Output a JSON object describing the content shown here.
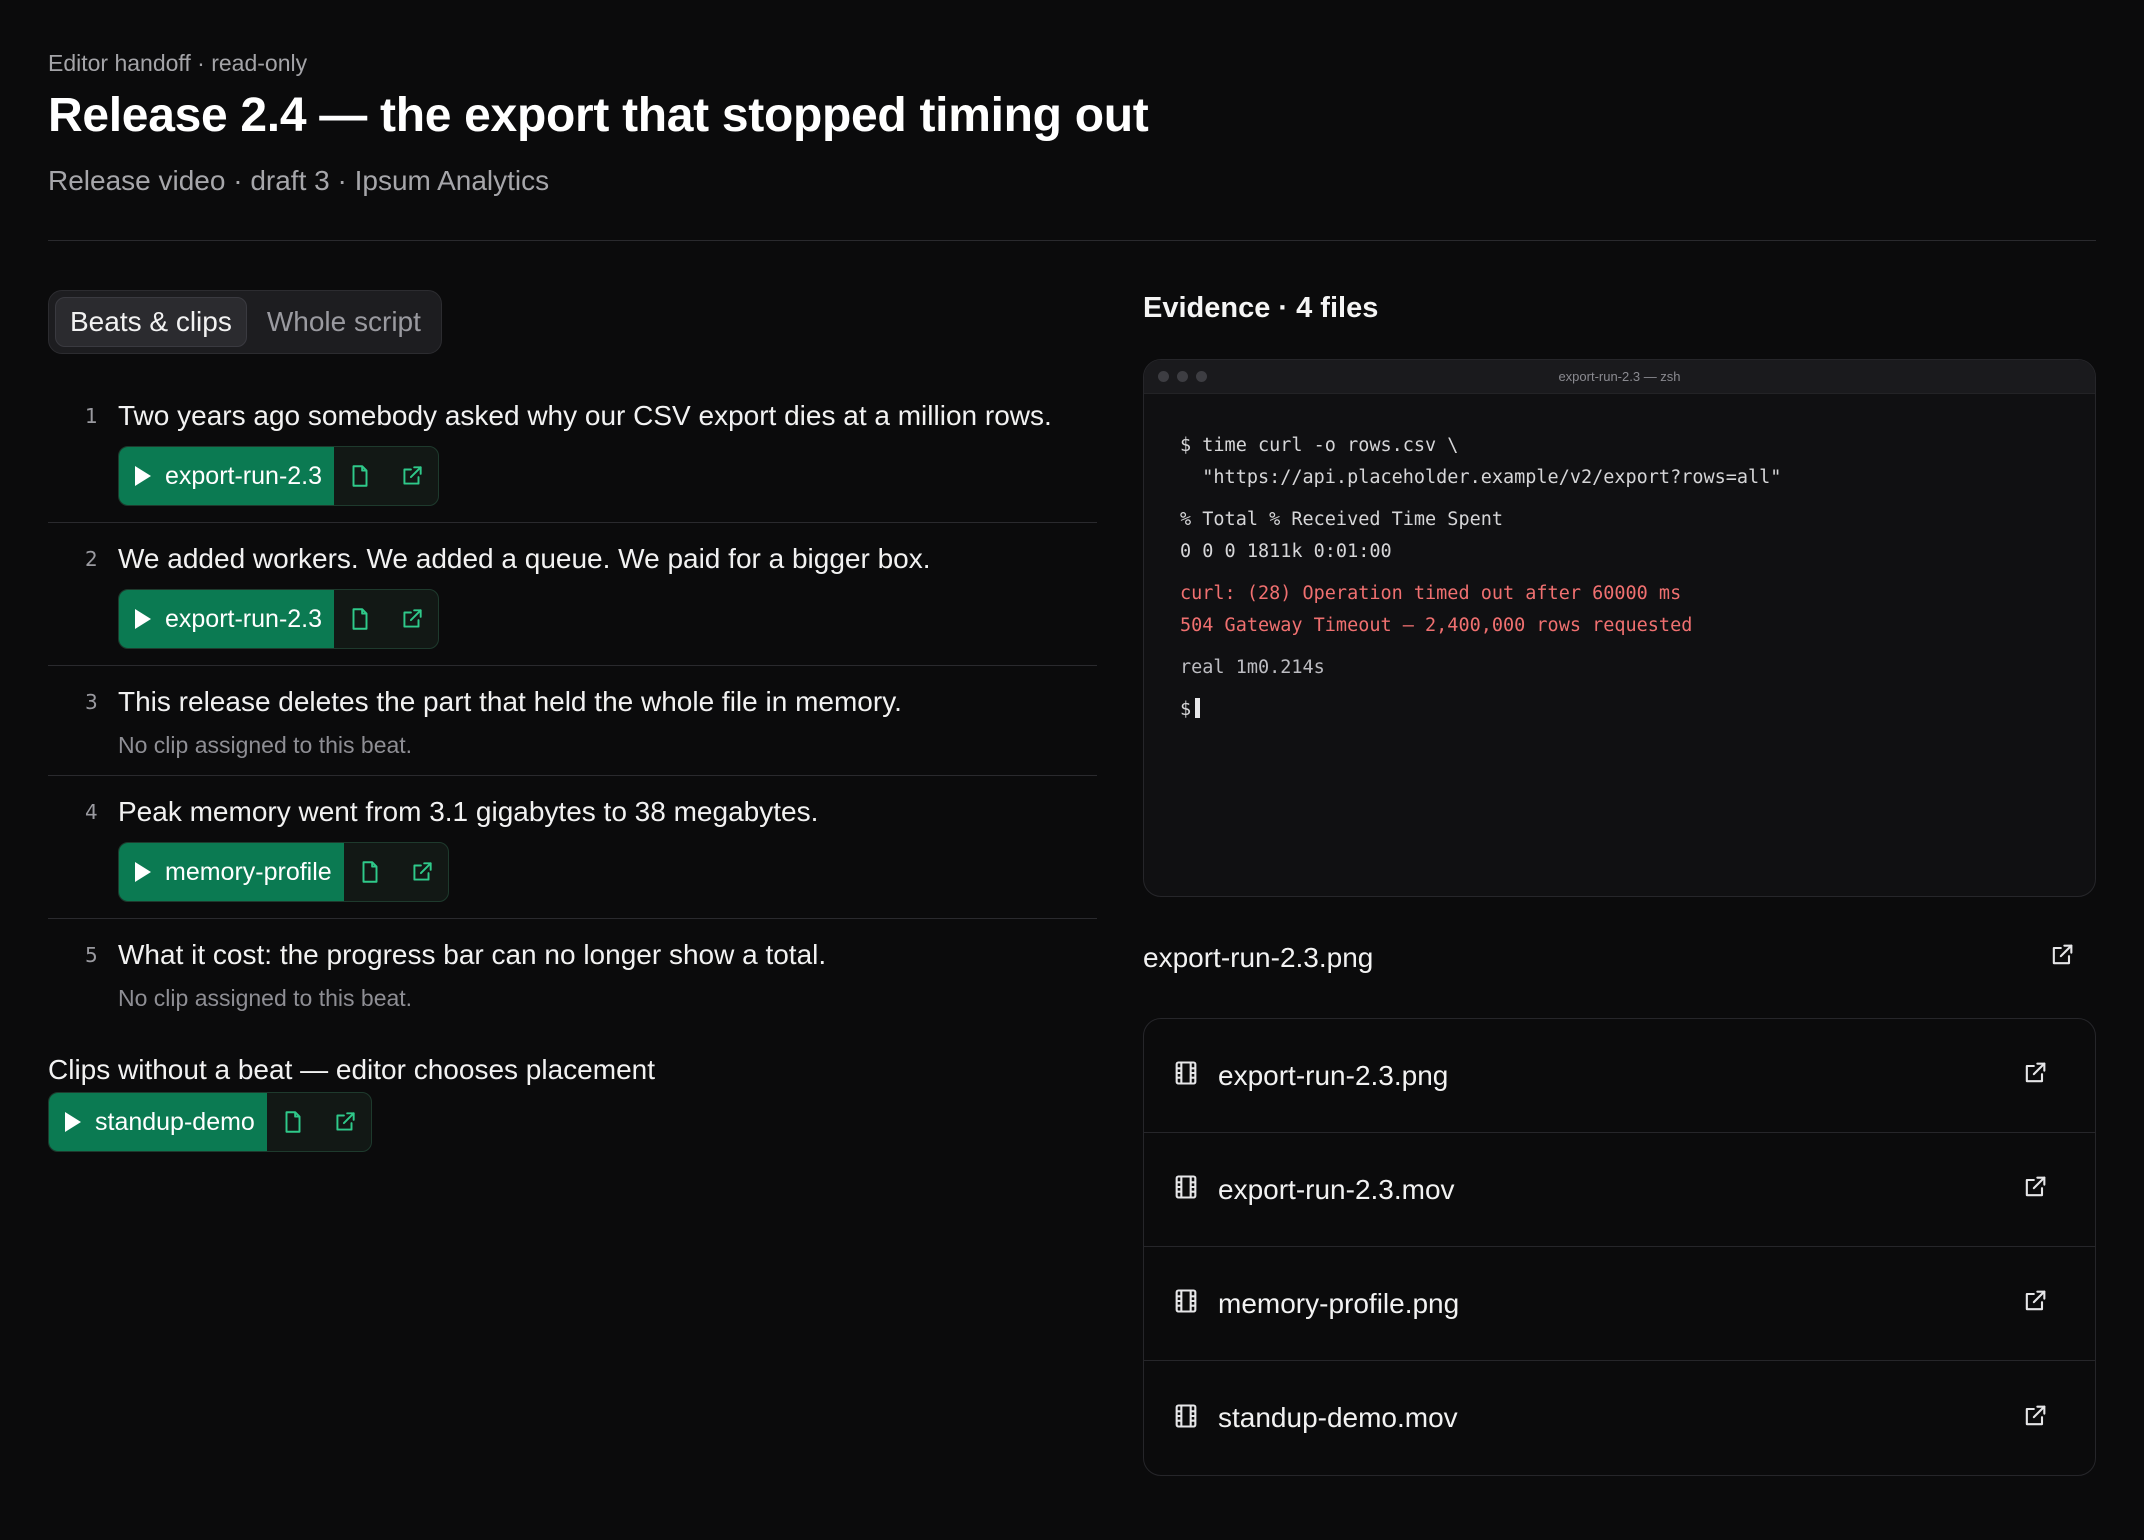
{
  "header": {
    "eyebrow": "Editor handoff · read-only",
    "title": "Release 2.4 — the export that stopped timing out",
    "subtitle": "Release video · draft 3 · Ipsum Analytics"
  },
  "tabs": [
    {
      "label": "Beats & clips",
      "active": true
    },
    {
      "label": "Whole script",
      "active": false
    }
  ],
  "beats": [
    {
      "num": "1",
      "text": "Two years ago somebody asked why our CSV export dies at a million rows.",
      "clip": "export-run-2.3"
    },
    {
      "num": "2",
      "text": "We added workers. We added a queue. We paid for a bigger box.",
      "clip": "export-run-2.3"
    },
    {
      "num": "3",
      "text": "This release deletes the part that held the whole file in memory.",
      "note": "No clip assigned to this beat."
    },
    {
      "num": "4",
      "text": "Peak memory went from 3.1 gigabytes to 38 megabytes.",
      "clip": "memory-profile"
    },
    {
      "num": "5",
      "text": "What it cost: the progress bar can no longer show a total.",
      "note": "No clip assigned to this beat."
    }
  ],
  "orphans": {
    "heading": "Clips without a beat — editor chooses placement",
    "clip": "standup-demo"
  },
  "evidence": {
    "title": "Evidence · 4 files",
    "terminal": {
      "window_title": "export-run-2.3 — zsh",
      "lines": [
        "$ time curl -o rows.csv \\",
        "  \"https://api.placeholder.example/v2/export?rows=all\"",
        "% Total % Received Time Spent",
        "0 0 0 1811k 0:01:00",
        "curl: (28) Operation timed out after 60000 ms",
        "504 Gateway Timeout — 2,400,000 rows requested",
        "real 1m0.214s",
        "$"
      ]
    },
    "selected": "export-run-2.3.png",
    "files": [
      {
        "name": "export-run-2.3.png"
      },
      {
        "name": "export-run-2.3.mov"
      },
      {
        "name": "memory-profile.png"
      },
      {
        "name": "standup-demo.mov"
      }
    ]
  },
  "colors": {
    "background": "#0b0b0c",
    "accent_green": "#0b7a52",
    "clip_icon_green": "#2fc98a",
    "error_red": "#f07070"
  },
  "icons": {
    "play": "play-icon",
    "file": "file-icon",
    "external": "external-link-icon",
    "film": "film-icon"
  }
}
